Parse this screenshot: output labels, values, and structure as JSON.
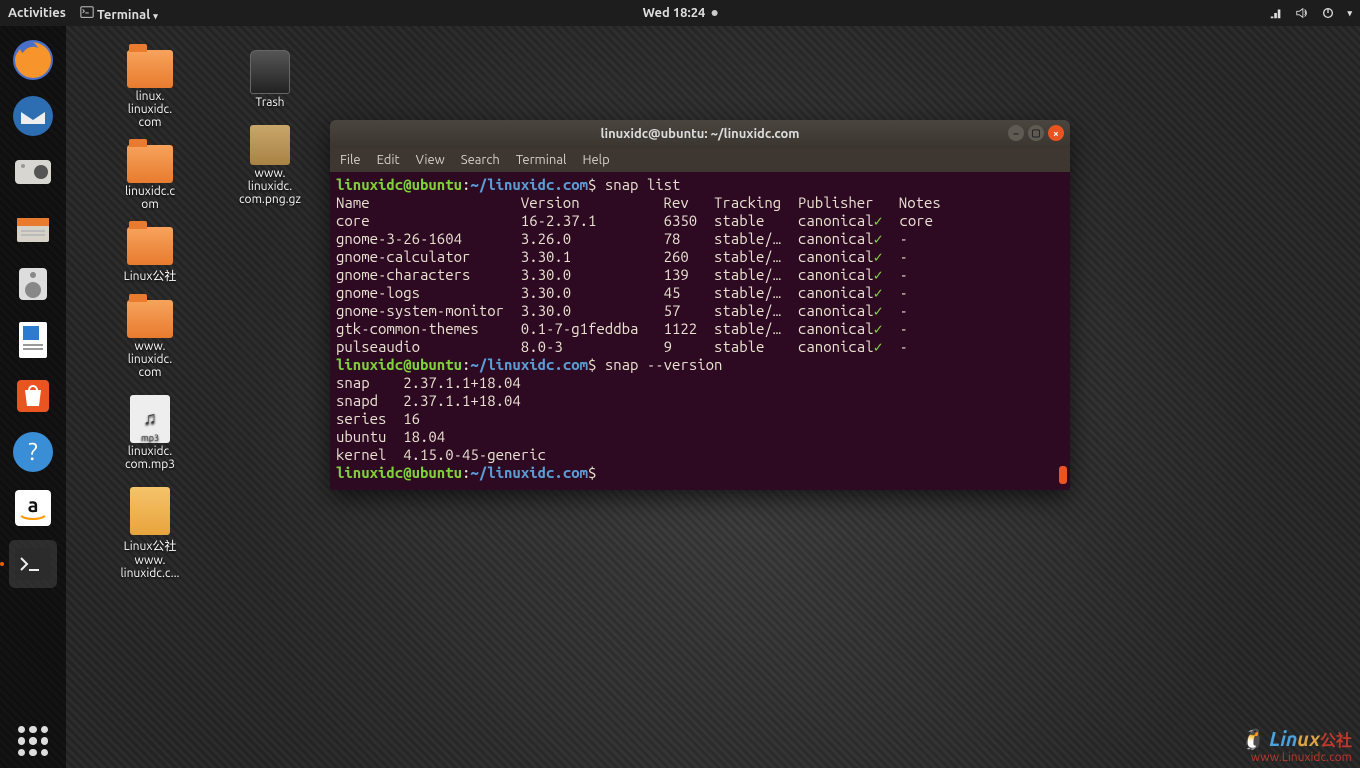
{
  "topbar": {
    "activities": "Activities",
    "app_menu": "Terminal",
    "clock": "Wed 18:24"
  },
  "desktop_icons": {
    "col1": [
      {
        "name": "folder",
        "label": "linux.\nlinuxidc.\ncom"
      },
      {
        "name": "folder",
        "label": "linuxidc.c\nom"
      },
      {
        "name": "folder",
        "label": "Linux公社"
      },
      {
        "name": "folder",
        "label": "www.\nlinuxidc.\ncom"
      },
      {
        "name": "mp3",
        "label": "linuxidc.\ncom.mp3"
      },
      {
        "name": "video",
        "label": "Linux公社\nwww.\nlinuxidc.c..."
      }
    ],
    "col2": [
      {
        "name": "trash",
        "label": "Trash"
      },
      {
        "name": "archive",
        "label": "www.\nlinuxidc.\ncom.png.gz"
      }
    ]
  },
  "terminal": {
    "title": "linuxidc@ubuntu: ~/linuxidc.com",
    "menu": [
      "File",
      "Edit",
      "View",
      "Search",
      "Terminal",
      "Help"
    ],
    "prompt_user": "linuxidc@ubuntu",
    "prompt_path": "~/linuxidc.com",
    "cmd1": "snap list",
    "header": {
      "name": "Name",
      "version": "Version",
      "rev": "Rev",
      "tracking": "Tracking",
      "publisher": "Publisher",
      "notes": "Notes"
    },
    "snaps": [
      {
        "name": "core",
        "version": "16-2.37.1",
        "rev": "6350",
        "tracking": "stable",
        "publisher": "canonical",
        "notes": "core"
      },
      {
        "name": "gnome-3-26-1604",
        "version": "3.26.0",
        "rev": "78",
        "tracking": "stable/…",
        "publisher": "canonical",
        "notes": "-"
      },
      {
        "name": "gnome-calculator",
        "version": "3.30.1",
        "rev": "260",
        "tracking": "stable/…",
        "publisher": "canonical",
        "notes": "-"
      },
      {
        "name": "gnome-characters",
        "version": "3.30.0",
        "rev": "139",
        "tracking": "stable/…",
        "publisher": "canonical",
        "notes": "-"
      },
      {
        "name": "gnome-logs",
        "version": "3.30.0",
        "rev": "45",
        "tracking": "stable/…",
        "publisher": "canonical",
        "notes": "-"
      },
      {
        "name": "gnome-system-monitor",
        "version": "3.30.0",
        "rev": "57",
        "tracking": "stable/…",
        "publisher": "canonical",
        "notes": "-"
      },
      {
        "name": "gtk-common-themes",
        "version": "0.1-7-g1feddba",
        "rev": "1122",
        "tracking": "stable/…",
        "publisher": "canonical",
        "notes": "-"
      },
      {
        "name": "pulseaudio",
        "version": "8.0-3",
        "rev": "9",
        "tracking": "stable",
        "publisher": "canonical",
        "notes": "-"
      }
    ],
    "cmd2": "snap --version",
    "version_lines": [
      {
        "k": "snap",
        "v": "2.37.1.1+18.04"
      },
      {
        "k": "snapd",
        "v": "2.37.1.1+18.04"
      },
      {
        "k": "series",
        "v": "16"
      },
      {
        "k": "ubuntu",
        "v": "18.04"
      },
      {
        "k": "kernel",
        "v": "4.15.0-45-generic"
      }
    ]
  },
  "watermark": {
    "text1": "Lin",
    "text2": "ux",
    "text3": "公社",
    "url": "www.Linuxidc.com"
  }
}
